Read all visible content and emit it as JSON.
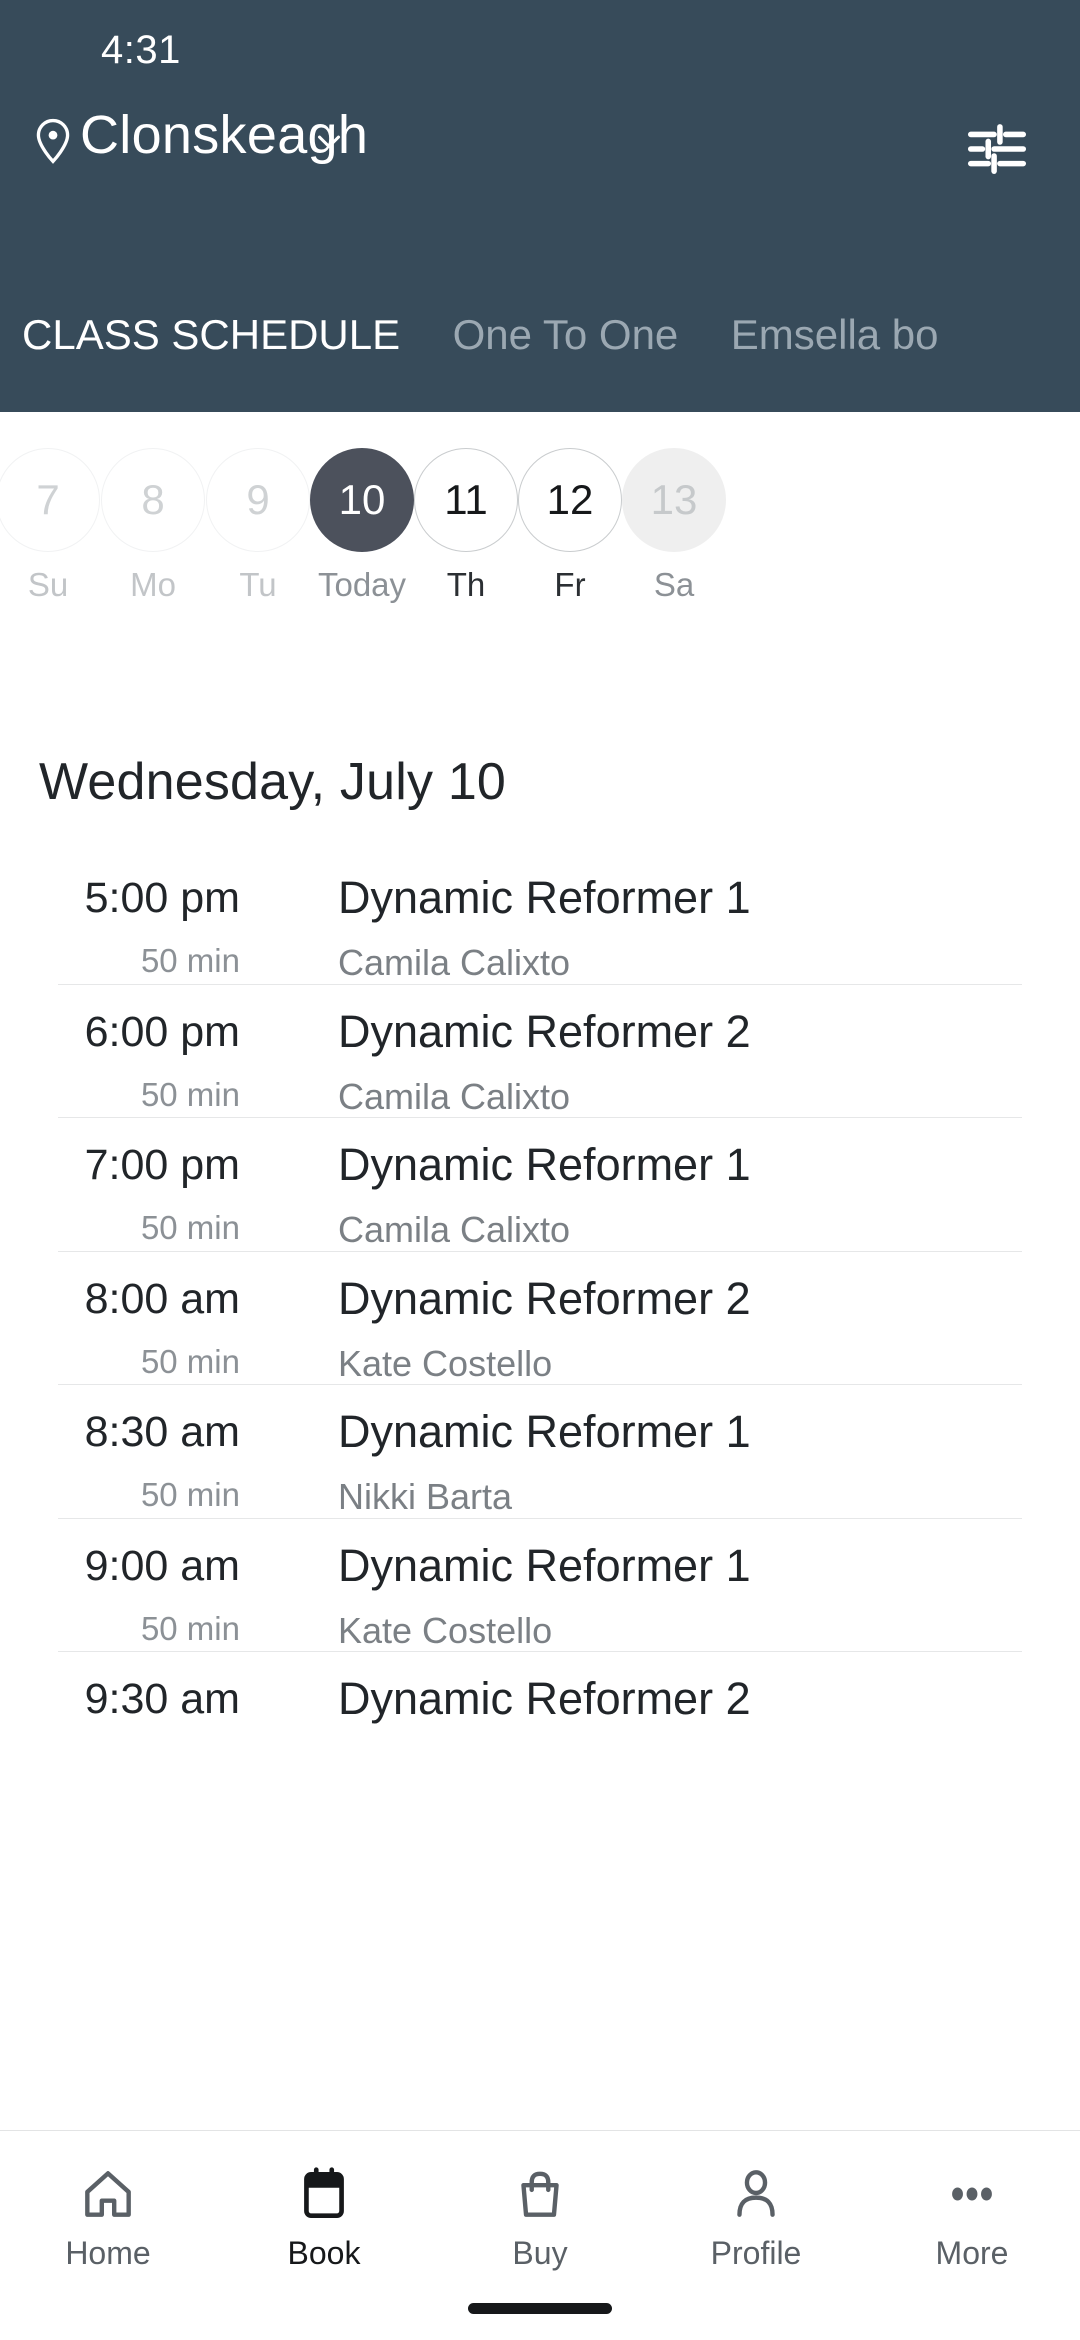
{
  "status_bar": {
    "time": "4:31"
  },
  "header": {
    "location": "Clonskeagh",
    "pin_icon": "location-pin-icon",
    "chevron_icon": "chevron-down-icon",
    "filter_icon": "filter-tune-icon",
    "background_color": "#374B5A",
    "tabs": [
      {
        "label": "CLASS SCHEDULE",
        "active": true
      },
      {
        "label": "One To One",
        "active": false
      },
      {
        "label": "Emsella bo",
        "active": false
      }
    ]
  },
  "date_strip": {
    "days": [
      {
        "date": "7",
        "label": "Su",
        "state": "past"
      },
      {
        "date": "8",
        "label": "Mo",
        "state": "past"
      },
      {
        "date": "9",
        "label": "Tu",
        "state": "past"
      },
      {
        "date": "10",
        "label": "Today",
        "state": "selected"
      },
      {
        "date": "11",
        "label": "Th",
        "state": "avail"
      },
      {
        "date": "12",
        "label": "Fr",
        "state": "avail"
      },
      {
        "date": "13",
        "label": "Sa",
        "state": "disabled"
      }
    ],
    "selected_color": "#4C515C"
  },
  "schedule": {
    "heading": "Wednesday, July 10",
    "classes": [
      {
        "time": "5:00 pm",
        "duration": "50 min",
        "title": "Dynamic Reformer 1",
        "instructor": "Camila Calixto"
      },
      {
        "time": "6:00 pm",
        "duration": "50 min",
        "title": "Dynamic Reformer 2",
        "instructor": "Camila Calixto"
      },
      {
        "time": "7:00 pm",
        "duration": "50 min",
        "title": "Dynamic Reformer 1",
        "instructor": "Camila Calixto"
      },
      {
        "time": "8:00 am",
        "duration": "50 min",
        "title": "Dynamic Reformer 2",
        "instructor": "Kate Costello"
      },
      {
        "time": "8:30 am",
        "duration": "50 min",
        "title": "Dynamic Reformer 1",
        "instructor": "Nikki Barta"
      },
      {
        "time": "9:00 am",
        "duration": "50 min",
        "title": "Dynamic Reformer 1",
        "instructor": "Kate Costello"
      },
      {
        "time": "9:30 am",
        "duration": "",
        "title": "Dynamic Reformer 2",
        "instructor": ""
      }
    ]
  },
  "bottom_nav": {
    "items": [
      {
        "label": "Home",
        "icon": "home-icon",
        "active": false
      },
      {
        "label": "Book",
        "icon": "calendar-icon",
        "active": true
      },
      {
        "label": "Buy",
        "icon": "shopping-bag-icon",
        "active": false
      },
      {
        "label": "Profile",
        "icon": "person-icon",
        "active": false
      },
      {
        "label": "More",
        "icon": "more-dots-icon",
        "active": false
      }
    ]
  }
}
